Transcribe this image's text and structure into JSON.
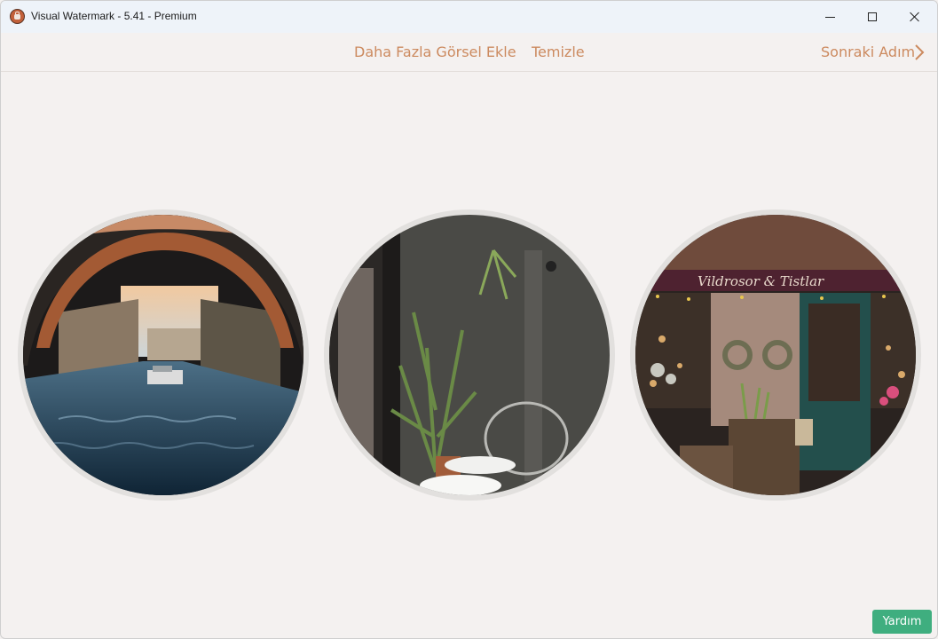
{
  "window": {
    "title": "Visual Watermark - 5.41 - Premium",
    "icon": "padlock-app-icon"
  },
  "toolbar": {
    "add_more_label": "Daha Fazla Görsel Ekle",
    "clear_label": "Temizle",
    "next_step_label": "Sonraki Adım",
    "accent_color": "#cc8a5f"
  },
  "gallery": {
    "images": [
      {
        "name": "canal-under-bridge-photo"
      },
      {
        "name": "cafe-plants-chairs-photo"
      },
      {
        "name": "flower-shop-storefront-photo"
      }
    ],
    "shop_sign_text": "Vildrosor & Tistlar"
  },
  "help": {
    "label": "Yardım",
    "color": "#3fae7f"
  }
}
